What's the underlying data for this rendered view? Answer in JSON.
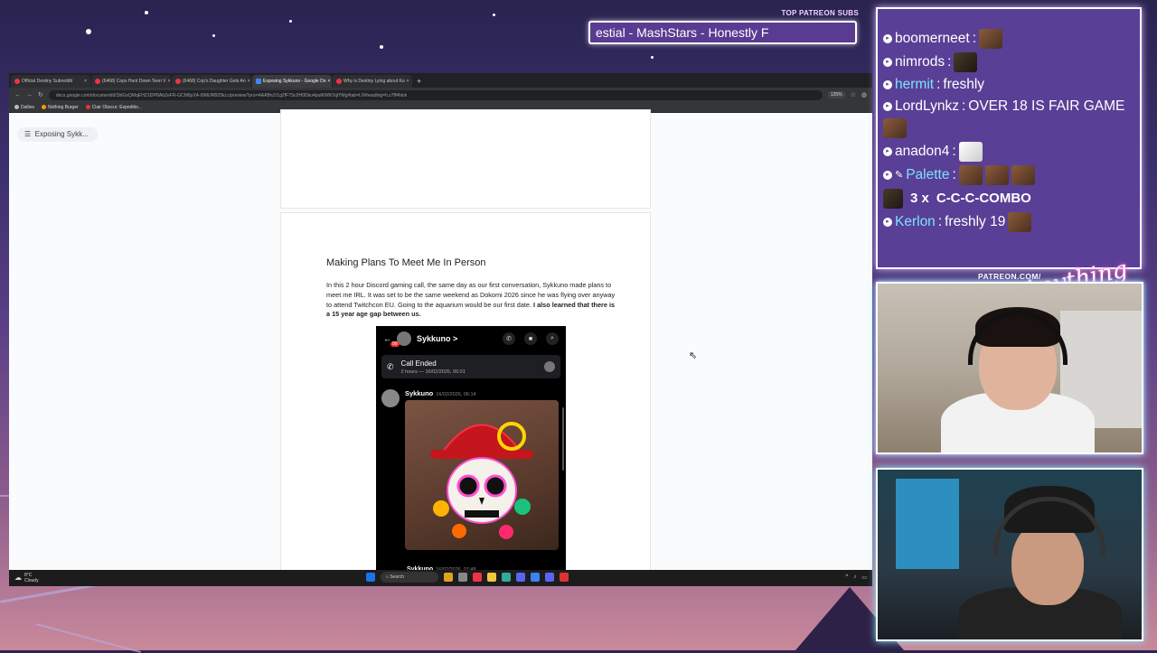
{
  "overlay": {
    "top_patreon_label": "TOP PATREON SUBS",
    "ticker_text": "estial - MashStars - Honestly F",
    "patreon_url_label": "PATREON.COM/",
    "logo_text": "Anything Else"
  },
  "browser": {
    "tabs": [
      {
        "label": "Official Destiny Subreddit",
        "close": "×",
        "icon": "reddit-icon"
      },
      {
        "label": "(6468) Cops Hunt Down Teen V",
        "close": "×",
        "icon": "youtube-icon"
      },
      {
        "label": "(6468) Cop's Daughter Gets An",
        "close": "×",
        "icon": "youtube-icon"
      },
      {
        "label": "Exposing Sykkuno - Google Do",
        "close": "×",
        "icon": "docs-icon"
      },
      {
        "label": "Why is Destiny Lying about Ku",
        "close": "×",
        "icon": "reddit-icon"
      }
    ],
    "new_tab": "+",
    "url": "docs.google.com/document/d/1bIGxQMqEHZ1f2P8AbZeFR-GCM6pXA-t9MlJRB25kLc/preview?pru=AAABnZr1g2fF7Sc0H0Dbu4pulKW6OqlYMg#tab=t.0#heading=h.z7ff4htvk",
    "zoom": "125%",
    "bookmarks": [
      "Dailies",
      "Nothing Burger",
      "Clair Obscur: Expeditio..."
    ],
    "outline_chip": "Exposing Sykk..."
  },
  "document": {
    "heading": "Making Plans To Meet Me In Person",
    "paragraph": "In this 2 hour Discord gaming call, the same day as our first conversation, Sykkuno made plans to meet me IRL. It was set to be the same weekend as Dokomi 2026 since he was flying over anyway to attend Twitchcon EU. Going to the aquarium would be our first date.",
    "paragraph_bold": "I also learned that there is a 15 year age gap between us."
  },
  "phone": {
    "back_badge": "99",
    "contact_name": "Sykkuno >",
    "call_title": "Call Ended",
    "call_sub": "2 hours — 16/02/2026, 06:01",
    "msg1_name": "Sykkuno",
    "msg1_time": "16/02/2026, 06:14",
    "msg2_name": "Sykkuno",
    "msg2_time": "16/02/2026, 07:48"
  },
  "taskbar": {
    "temp": "8°C",
    "weather": "Cloudy",
    "search": "Search"
  },
  "chat": {
    "lines": [
      {
        "user": "boomerneet",
        "sep": ":",
        "text": ""
      },
      {
        "user": "nimrods",
        "sep": ":",
        "text": ""
      },
      {
        "user": "hermit",
        "sep": ":",
        "text": "freshly"
      },
      {
        "user": "LordLynkz",
        "sep": ":",
        "text": "OVER 18 IS FAIR GAME"
      },
      {
        "user": "anadon4",
        "sep": ":",
        "text": ""
      },
      {
        "user": "Palette",
        "sep": ":",
        "text": ""
      },
      {
        "user": "",
        "sep": "",
        "text": ""
      },
      {
        "user": "Kerlon",
        "sep": ":",
        "text": "freshly 19"
      }
    ],
    "combo_count": "3 x",
    "combo_text": "C-C-C-COMBO"
  },
  "colors": {
    "chat_bg": "#5a3f96",
    "cyan_user": "#7ee0ff",
    "doc_bg": "#f9fbfd"
  }
}
